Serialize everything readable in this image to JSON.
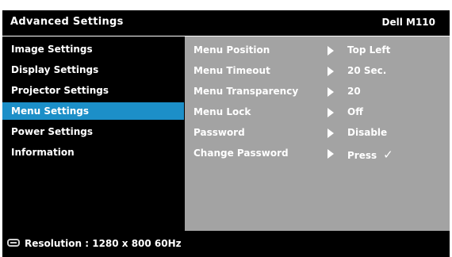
{
  "header": {
    "title": "Advanced Settings",
    "model": "Dell  M110"
  },
  "left_menu": [
    {
      "label": "Image Settings"
    },
    {
      "label": "Display Settings"
    },
    {
      "label": "Projector Settings"
    },
    {
      "label": "Menu Settings",
      "active": true
    },
    {
      "label": "Power Settings"
    },
    {
      "label": "Information"
    }
  ],
  "options": [
    {
      "name": "Menu Position",
      "value": "Top Left"
    },
    {
      "name": "Menu Timeout",
      "value": "20 Sec."
    },
    {
      "name": "Menu Transparency",
      "value": "20"
    },
    {
      "name": "Menu Lock",
      "value": "Off"
    },
    {
      "name": "Password",
      "value": "Disable"
    },
    {
      "name": "Change Password",
      "value": "Press",
      "check": "✓"
    }
  ],
  "footer": {
    "icon": "input-connector-icon",
    "resolution": "Resolution : 1280 x 800 60Hz"
  },
  "colors": {
    "active_bg": "#1c8fc8",
    "panel_bg": "#a3a3a3",
    "menu_bg": "#000000"
  }
}
